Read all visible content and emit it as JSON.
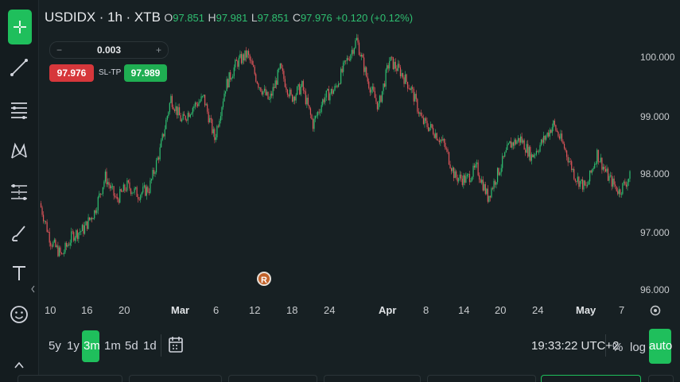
{
  "header": {
    "symbol": "USDIDX",
    "interval": "1h",
    "source": "XTB",
    "open": "97.851",
    "high": "97.981",
    "low": "97.851",
    "close": "97.976",
    "change": "+0.120 (+0.12%)"
  },
  "order_panel": {
    "quantity": "0.003",
    "minus": "−",
    "plus": "+",
    "sell_price": "97.976",
    "sltp_label": "SL-TP",
    "buy_price": "97.989"
  },
  "event_marker": "R",
  "bottom_bar": {
    "ranges": [
      "5y",
      "1y",
      "3m",
      "1m",
      "5d",
      "1d"
    ],
    "active_range": "3m",
    "time": "19:33:22 UTC+2",
    "percent_label": "%",
    "log_label": "log",
    "auto_label": "auto"
  },
  "colors": {
    "up": "#2fbf71",
    "down": "#e0555a",
    "accent": "#1fbf5c",
    "background": "#172023"
  },
  "tools": [
    "crosshair-icon",
    "trend-line-icon",
    "fib-levels-icon",
    "pattern-icon",
    "measure-icon",
    "brush-icon",
    "text-icon",
    "smiley-icon"
  ],
  "chart_data": {
    "type": "candlestick",
    "title": "USDIDX · 1h · XTB",
    "y_axis": {
      "ticks": [
        "100.000",
        "99.000",
        "98.000",
        "97.000",
        "96.000"
      ],
      "ylim": [
        95.95,
        100.45
      ]
    },
    "x_axis": {
      "ticks": [
        "10",
        "16",
        "20",
        "Mar",
        "6",
        "12",
        "18",
        "24",
        "Apr",
        "8",
        "14",
        "20",
        "24",
        "May",
        "7"
      ],
      "bold_ticks": [
        "Mar",
        "Apr",
        "May"
      ]
    },
    "close_path": [
      [
        "Feb 8",
        97.5
      ],
      [
        "Feb 10",
        96.85
      ],
      [
        "Feb 12",
        96.6
      ],
      [
        "Feb 14",
        96.95
      ],
      [
        "Feb 17",
        97.05
      ],
      [
        "Feb 19",
        97.35
      ],
      [
        "Feb 21",
        97.95
      ],
      [
        "Feb 23",
        97.55
      ],
      [
        "Feb 25",
        97.8
      ],
      [
        "Feb 27",
        97.65
      ],
      [
        "Feb 29",
        97.75
      ],
      [
        "Mar 1",
        98.4
      ],
      [
        "Mar 2",
        99.3
      ],
      [
        "Mar 4",
        98.9
      ],
      [
        "Mar 6",
        99.15
      ],
      [
        "Mar 8",
        99.3
      ],
      [
        "Mar 9",
        98.6
      ],
      [
        "Mar 11",
        99.5
      ],
      [
        "Mar 13",
        99.9
      ],
      [
        "Mar 14",
        100.05
      ],
      [
        "Mar 16",
        99.55
      ],
      [
        "Mar 18",
        99.25
      ],
      [
        "Mar 19",
        99.8
      ],
      [
        "Mar 21",
        99.3
      ],
      [
        "Mar 23",
        99.5
      ],
      [
        "Mar 24",
        98.85
      ],
      [
        "Mar 26",
        99.3
      ],
      [
        "Mar 28",
        99.45
      ],
      [
        "Mar 30",
        99.9
      ],
      [
        "Apr 1",
        100.3
      ],
      [
        "Apr 2",
        99.6
      ],
      [
        "Apr 3",
        99.15
      ],
      [
        "Apr 4",
        99.95
      ],
      [
        "Apr 6",
        99.75
      ],
      [
        "Apr 8",
        99.45
      ],
      [
        "Apr 9",
        98.9
      ],
      [
        "Apr 11",
        98.75
      ],
      [
        "Apr 13",
        98.5
      ],
      [
        "Apr 15",
        97.95
      ],
      [
        "Apr 17",
        97.9
      ],
      [
        "Apr 19",
        98.1
      ],
      [
        "Apr 21",
        97.6
      ],
      [
        "Apr 22",
        98.05
      ],
      [
        "Apr 24",
        98.5
      ],
      [
        "Apr 26",
        98.6
      ],
      [
        "Apr 28",
        98.3
      ],
      [
        "Apr 30",
        98.55
      ],
      [
        "May 1",
        98.85
      ],
      [
        "May 2",
        98.45
      ],
      [
        "May 3",
        97.95
      ],
      [
        "May 5",
        97.75
      ],
      [
        "May 6",
        98.35
      ],
      [
        "May 8",
        97.95
      ],
      [
        "May 9",
        97.7
      ],
      [
        "May 10",
        97.95
      ]
    ],
    "last_close": 97.976,
    "grid": false,
    "legend": "none"
  }
}
